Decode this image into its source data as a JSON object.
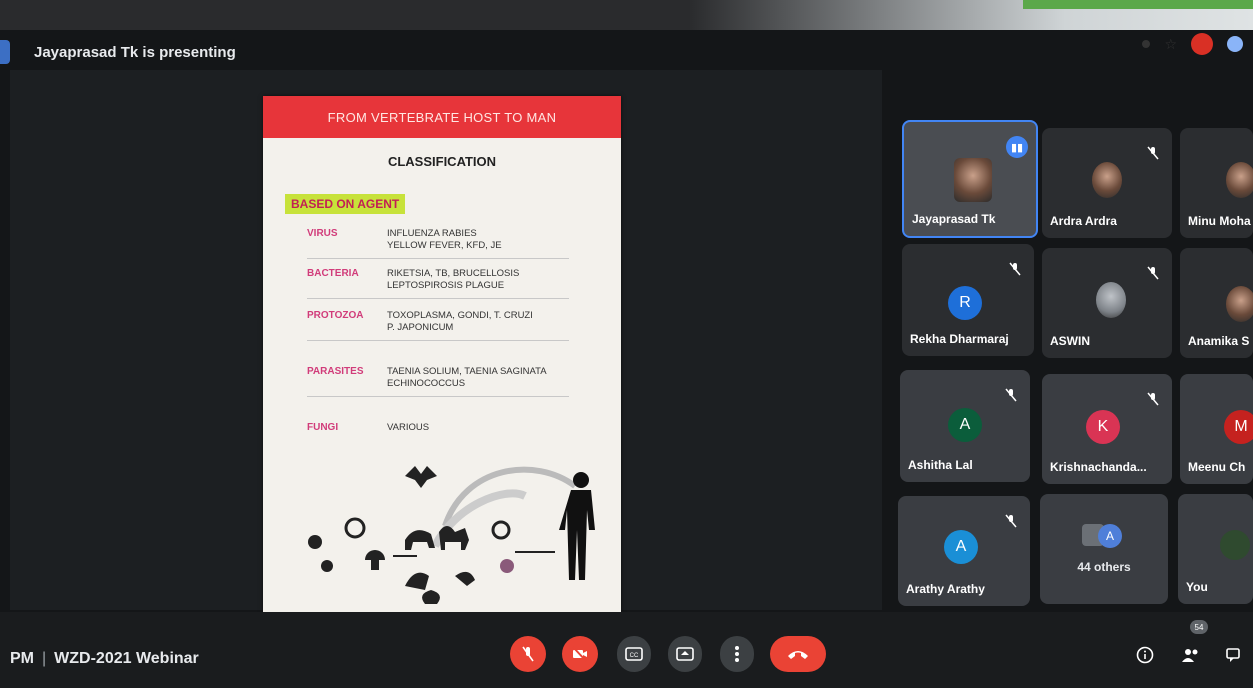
{
  "banner": {
    "presenting_text": "Jayaprasad Tk is presenting"
  },
  "slide": {
    "header": "FROM VERTEBRATE HOST TO MAN",
    "title": "CLASSIFICATION",
    "agent_label": "BASED ON AGENT",
    "rows": [
      {
        "category": "VIRUS",
        "line1": "INFLUENZA  RABIES",
        "line2": "YELLOW FEVER,  KFD, JE"
      },
      {
        "category": "BACTERIA",
        "line1": "RIKETSIA, TB, BRUCELLOSIS",
        "line2": "LEPTOSPIROSIS PLAGUE"
      },
      {
        "category": "PROTOZOA",
        "line1": "TOXOPLASMA, GONDI, T. CRUZI",
        "line2": "P. JAPONICUM"
      },
      {
        "category": "PARASITES",
        "line1": "TAENIA SOLIUM, TAENIA SAGINATA",
        "line2": "ECHINOCOCCUS"
      },
      {
        "category": "FUNGI",
        "line1": "VARIOUS",
        "line2": ""
      }
    ]
  },
  "participants": [
    {
      "name": "Jayaprasad Tk",
      "speaking": true
    },
    {
      "name": "Ardra Ardra",
      "muted": true
    },
    {
      "name": "Minu Moha"
    },
    {
      "name": "Rekha Dharmaraj",
      "initial": "R",
      "color": "#1e6fd9",
      "muted": true
    },
    {
      "name": "ASWIN",
      "muted": true
    },
    {
      "name": "Anamika S"
    },
    {
      "name": "Ashitha Lal",
      "initial": "A",
      "color": "#0b5d3b",
      "muted": true
    },
    {
      "name": "Krishnachanda...",
      "initial": "K",
      "color": "#d93454",
      "muted": true
    },
    {
      "name": "Meenu Ch",
      "initial": "M",
      "color": "#c5221f"
    },
    {
      "name": "Arathy Arathy",
      "initial": "A",
      "color": "#1a8fd6",
      "muted": true
    },
    {
      "name": "44 others",
      "initial": "A",
      "color": "#4f7fd9"
    },
    {
      "name": "You"
    }
  ],
  "bottom": {
    "time_fragment": "PM",
    "meeting_name": "WZD-2021 Webinar",
    "people_count": "54"
  },
  "colors": {
    "accent_red": "#ea4335",
    "control_grey": "#3c4043",
    "speaking_blue": "#4285f4"
  }
}
